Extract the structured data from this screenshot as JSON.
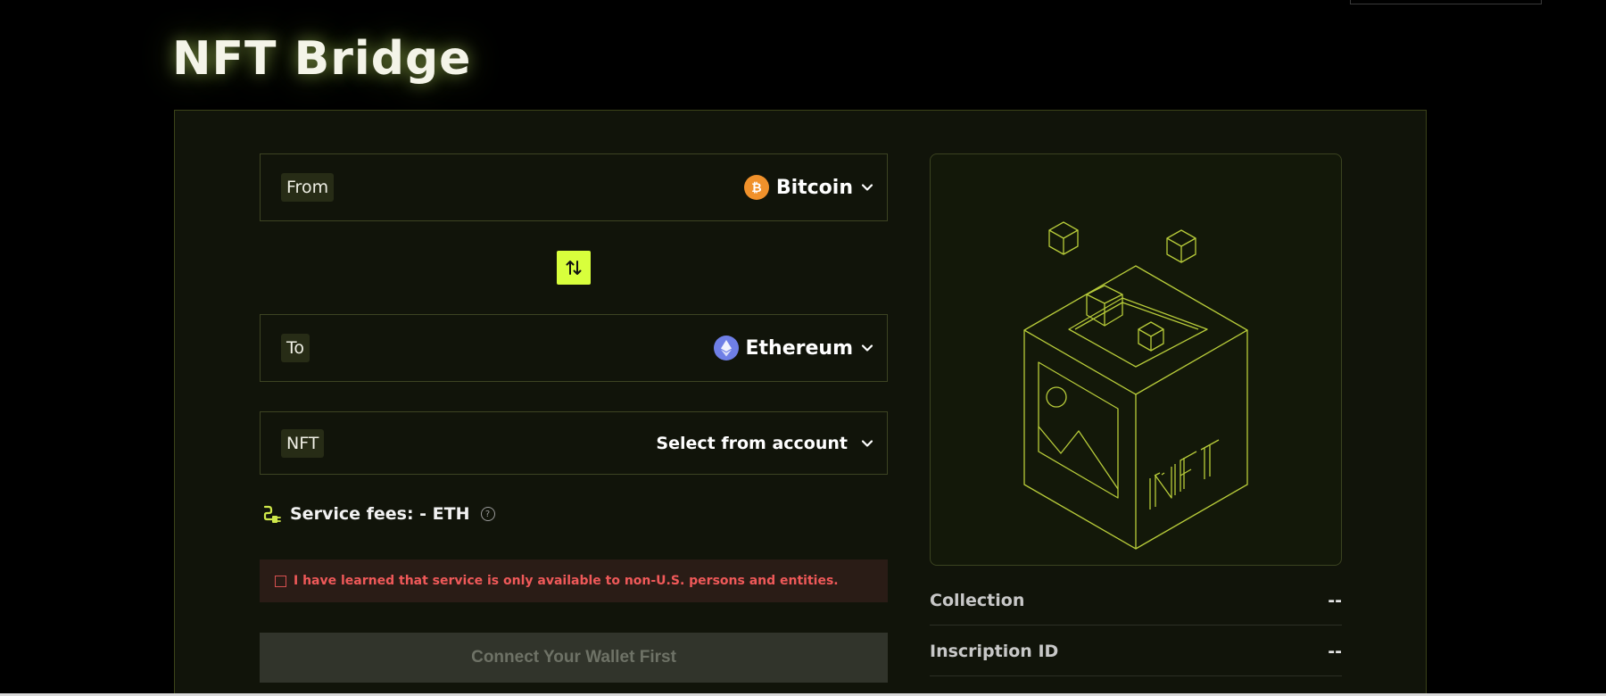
{
  "header": {
    "title": "NFT Bridge"
  },
  "from_field": {
    "tag": "From",
    "chain": "Bitcoin",
    "icon": "bitcoin-icon",
    "icon_color": "#f0912b"
  },
  "to_field": {
    "tag": "To",
    "chain": "Ethereum",
    "icon": "ethereum-icon",
    "icon_color": "#6f7fe6"
  },
  "nft_field": {
    "tag": "NFT",
    "select_label": "Select from account"
  },
  "swap": {
    "icon": "swap-arrows-icon",
    "color": "#d8ff3c"
  },
  "fees": {
    "label": "Service fees: - ETH",
    "icon": "fee-plug-icon"
  },
  "notice": {
    "text": "I have learned that service is only available to non-U.S. persons and entities.",
    "color": "#ef5959"
  },
  "connect_button": {
    "label": "Connect Your Wallet First"
  },
  "preview": {
    "illustration_text": "NFT"
  },
  "details": [
    {
      "label": "Collection",
      "value": "--"
    },
    {
      "label": "Inscription ID",
      "value": "--"
    }
  ]
}
